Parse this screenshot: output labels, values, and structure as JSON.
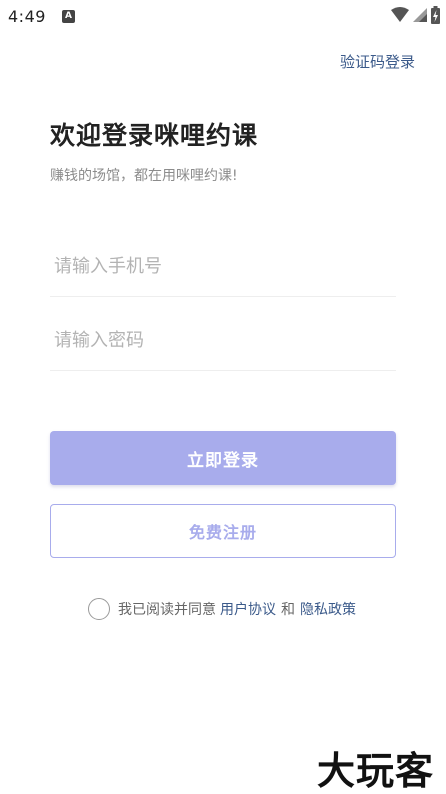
{
  "status_bar": {
    "time": "4:49",
    "left_icon": "A",
    "icons": [
      "wifi-icon",
      "signal-icon",
      "battery-charging-icon"
    ]
  },
  "header": {
    "sms_login": "验证码登录"
  },
  "main": {
    "title": "欢迎登录咪哩约课",
    "subtitle": "赚钱的场馆，都在用咪哩约课!",
    "phone_placeholder": "请输入手机号",
    "password_placeholder": "请输入密码",
    "login_label": "立即登录",
    "register_label": "免费注册"
  },
  "agreement": {
    "prefix": "我已阅读并同意",
    "user_agreement": "用户协议",
    "and": "和",
    "privacy_policy": "隐私政策"
  },
  "watermark": "大玩客",
  "colors": {
    "accent": "#a8acec",
    "link": "#3b5a8a"
  }
}
